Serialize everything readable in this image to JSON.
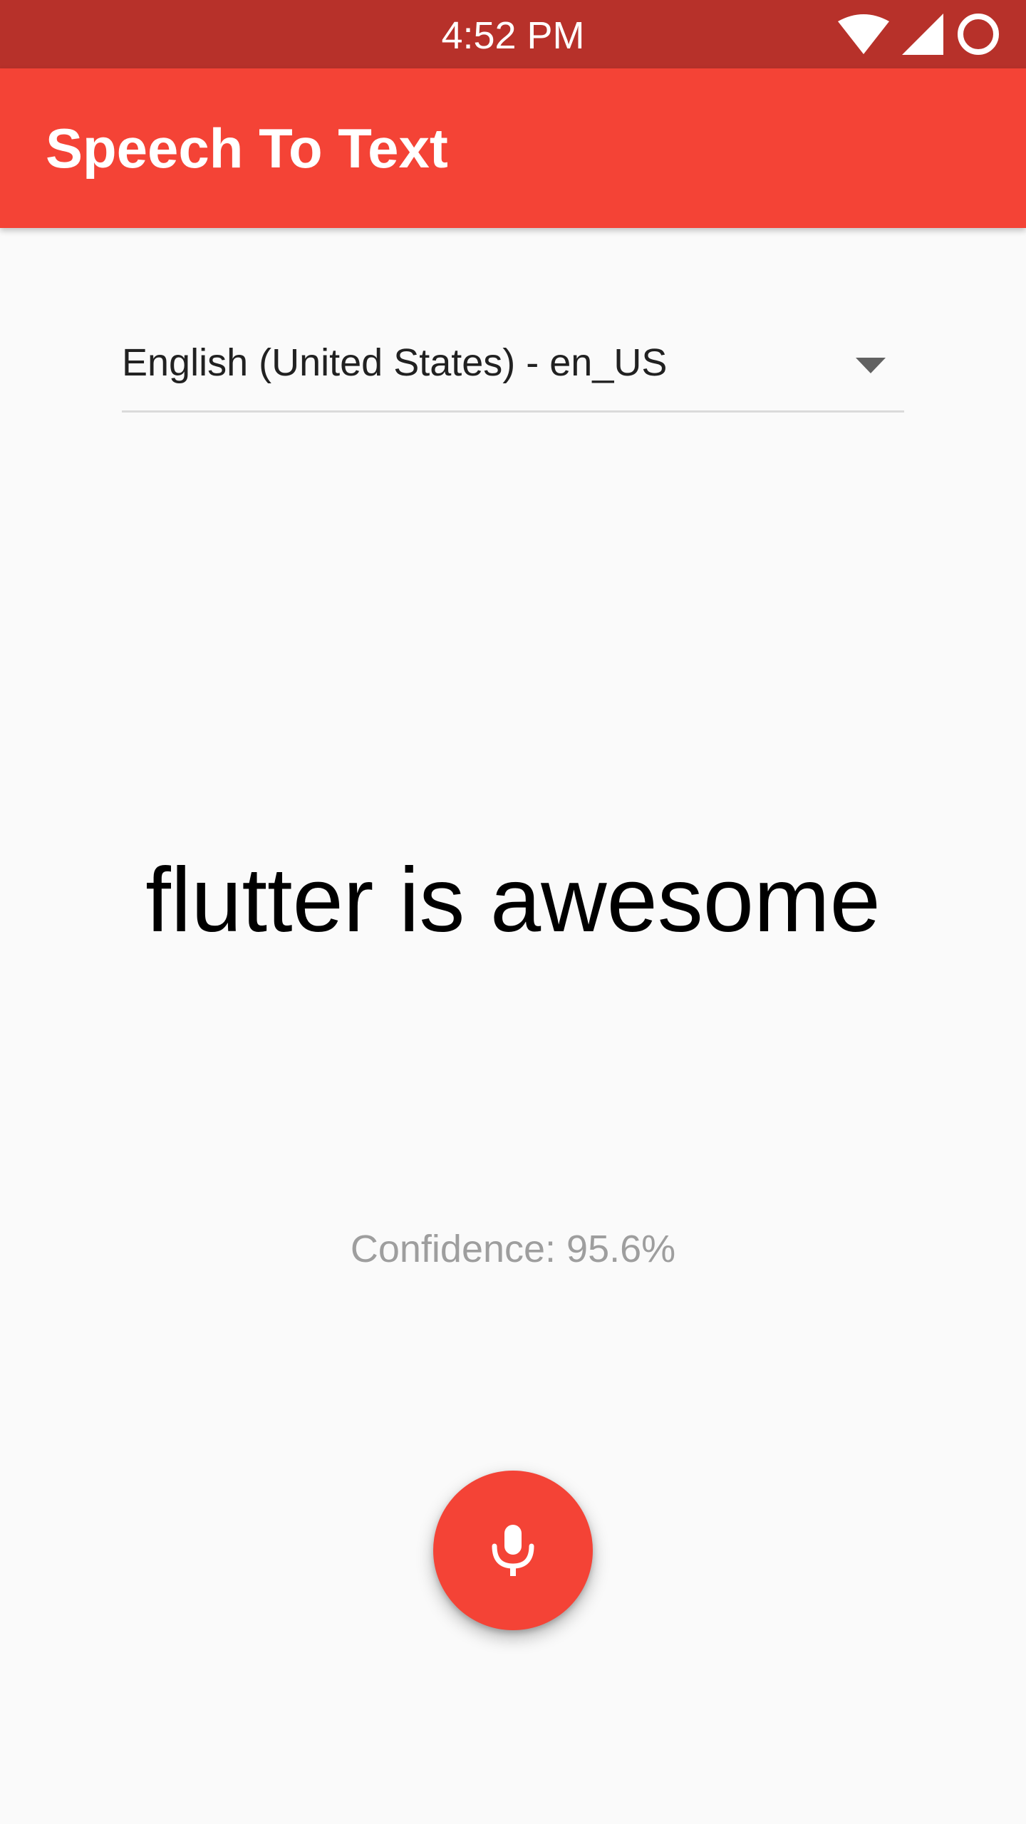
{
  "status_bar": {
    "time": "4:52 PM",
    "icons": [
      "wifi-icon",
      "cellular-signal-icon",
      "battery-circle-icon"
    ]
  },
  "app_bar": {
    "title": "Speech To Text",
    "color": "#f44336"
  },
  "locale_dropdown": {
    "selected": "English (United States) - en_US",
    "icon": "dropdown-arrow-icon"
  },
  "recognized_text": "flutter is awesome",
  "confidence_text": "Confidence: 95.6%",
  "mic_button": {
    "icon": "microphone-icon",
    "color": "#f44336"
  },
  "colors": {
    "status_bar": "#b7312a",
    "accent": "#f44336",
    "background": "#fafafa"
  }
}
